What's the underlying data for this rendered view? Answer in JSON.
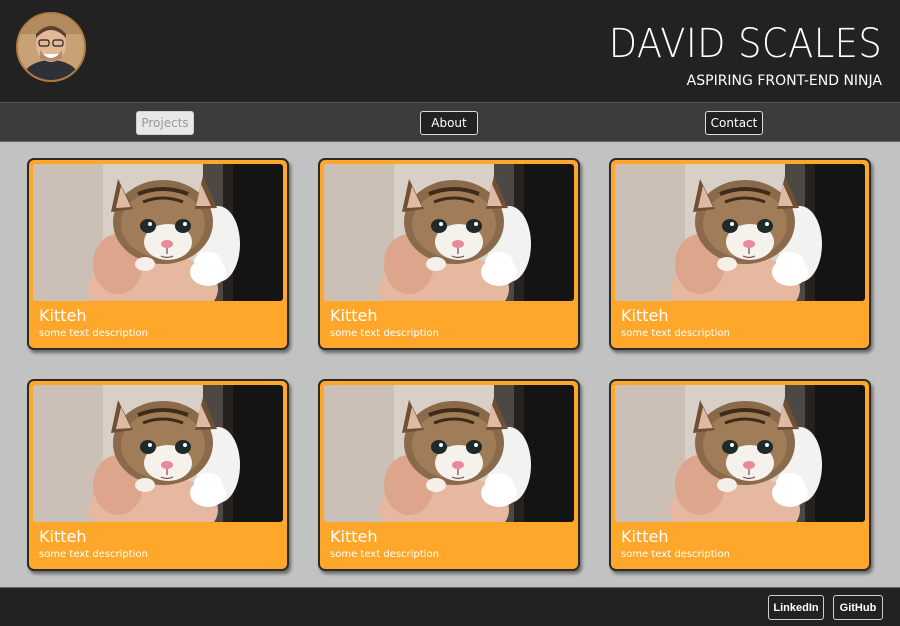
{
  "header": {
    "title": "DAVID SCALES",
    "subtitle": "ASPIRING FRONT-END NINJA",
    "avatar_icon": "avatar-photo"
  },
  "nav": {
    "projects": "Projects",
    "about": "About",
    "contact": "Contact",
    "active": "projects"
  },
  "cards": [
    {
      "title": "Kitteh",
      "description": "some text description",
      "image": "kitten-photo"
    },
    {
      "title": "Kitteh",
      "description": "some text description",
      "image": "kitten-photo"
    },
    {
      "title": "Kitteh",
      "description": "some text description",
      "image": "kitten-photo"
    },
    {
      "title": "Kitteh",
      "description": "some text description",
      "image": "kitten-photo"
    },
    {
      "title": "Kitteh",
      "description": "some text description",
      "image": "kitten-photo"
    },
    {
      "title": "Kitteh",
      "description": "some text description",
      "image": "kitten-photo"
    }
  ],
  "footer": {
    "linkedin": "LinkedIn",
    "github": "GitHub"
  },
  "colors": {
    "header_bg": "#222222",
    "nav_bg": "#3c3c3c",
    "page_bg": "#c2c2c2",
    "card_accent": "#ffa72a"
  }
}
